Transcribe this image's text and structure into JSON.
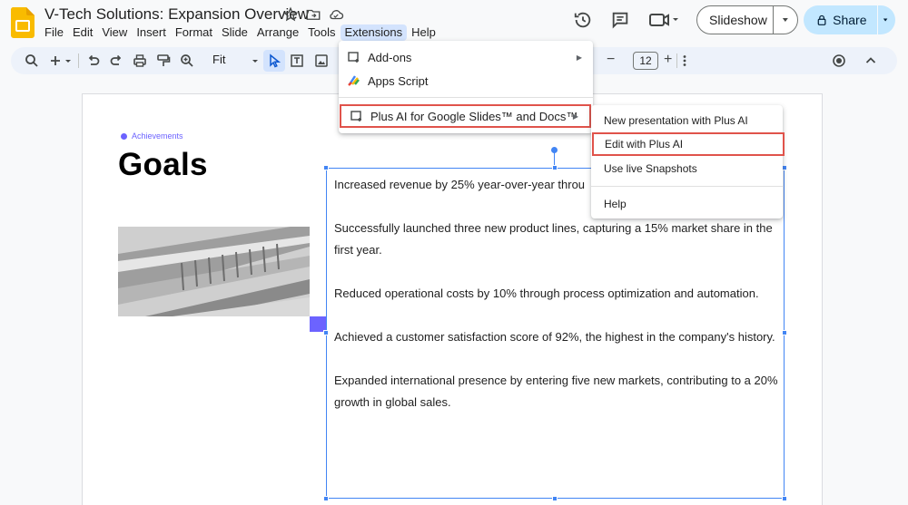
{
  "document": {
    "title": "V-Tech Solutions: Expansion Overview"
  },
  "menu_bar": {
    "items": [
      "File",
      "Edit",
      "View",
      "Insert",
      "Format",
      "Slide",
      "Arrange",
      "Tools",
      "Extensions",
      "Help"
    ],
    "active_item": "Extensions"
  },
  "header": {
    "slideshow_label": "Slideshow",
    "share_label": "Share"
  },
  "toolbar": {
    "zoom_value": "Fit",
    "font_size": "12"
  },
  "extensions_menu": {
    "addons_label": "Add-ons",
    "apps_script_label": "Apps Script",
    "plus_ai_label": "Plus AI for Google Slides™ and Docs™"
  },
  "plus_ai_submenu": {
    "new_presentation_label": "New presentation with Plus AI",
    "edit_label": "Edit with Plus AI",
    "live_snapshots_label": "Use live Snapshots",
    "help_label": "Help"
  },
  "slide": {
    "eyebrow": "Achievements",
    "title": "Goals",
    "paragraphs": [
      "Increased revenue by 25% year-over-year throu",
      "Successfully launched three new product lines, capturing a 15% market share in the first year.",
      "Reduced operational costs by 10% through process optimization and automation.",
      "Achieved a customer satisfaction score of 92%, the highest in the company's history.",
      "Expanded international presence by entering five new markets, contributing to a 20% growth in global sales."
    ]
  },
  "colors": {
    "accent_purple": "#6c63ff",
    "selection_blue": "#4285f4",
    "highlight_red": "#e0534b",
    "share_button_bg": "#c2e7ff",
    "active_menu_bg": "#d3e3fd"
  },
  "icons": [
    "slides-logo-icon",
    "star-icon",
    "move-to-folder-icon",
    "cloud-status-icon",
    "history-icon",
    "comment-icon",
    "video-call-icon",
    "lock-icon",
    "search-icon",
    "add-icon",
    "undo-icon",
    "redo-icon",
    "print-icon",
    "paint-format-icon",
    "zoom-icon",
    "select-icon",
    "text-box-icon",
    "image-icon",
    "more-icon",
    "record-icon",
    "collapse-icon"
  ]
}
